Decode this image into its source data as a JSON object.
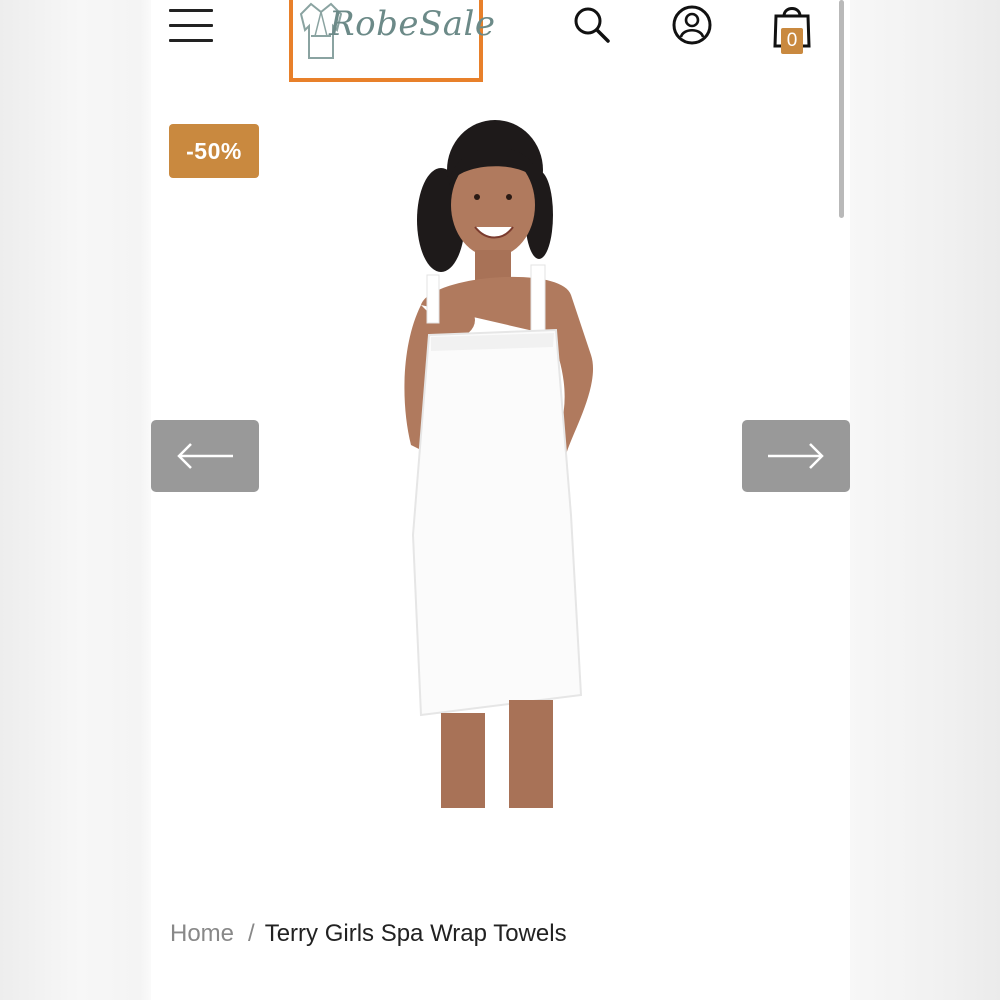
{
  "header": {
    "logo_text": "RobeSale",
    "logo_alt": "RobeSale",
    "cart_count": "0",
    "icons": [
      "menu-icon",
      "robe-logo-icon",
      "search-icon",
      "account-icon",
      "shopping-bag-icon"
    ]
  },
  "product": {
    "badge": "-50%",
    "image_alt": "Terry Girls Spa Wrap Towels"
  },
  "carousel": {
    "prev_icon": "arrow-left-icon",
    "next_icon": "arrow-right-icon"
  },
  "breadcrumb": {
    "home": "Home",
    "separator": "/",
    "current": "Terry Girls Spa Wrap Towels"
  },
  "colors": {
    "accent": "#c9893f",
    "logo_border": "#e8802a",
    "arrow_bg": "#999999"
  }
}
